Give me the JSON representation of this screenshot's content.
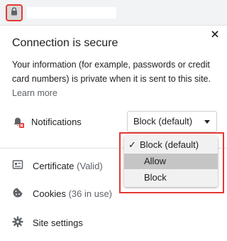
{
  "header": {
    "lock_icon": "lock-icon"
  },
  "popup": {
    "title": "Connection is secure",
    "description": "Your information (for example, passwords or credit card numbers) is private when it is sent to this site.",
    "learn_more": "Learn more",
    "close_icon": "close-icon"
  },
  "notifications": {
    "label": "Notifications",
    "icon": "notifications-blocked-icon",
    "selected_value": "Block (default)"
  },
  "dropdown": {
    "options": [
      {
        "label": "Block (default)",
        "checked": true
      },
      {
        "label": "Allow",
        "highlighted": true
      },
      {
        "label": "Block"
      }
    ]
  },
  "menu": [
    {
      "label": "Certificate",
      "sub": "(Valid)",
      "icon": "certificate-icon"
    },
    {
      "label": "Cookies",
      "sub": "(36 in use)",
      "icon": "cookie-icon"
    },
    {
      "label": "Site settings",
      "sub": "",
      "icon": "gear-icon"
    }
  ],
  "colors": {
    "highlight_border": "#e53935",
    "selected_option_bg": "#c5c5c5"
  }
}
